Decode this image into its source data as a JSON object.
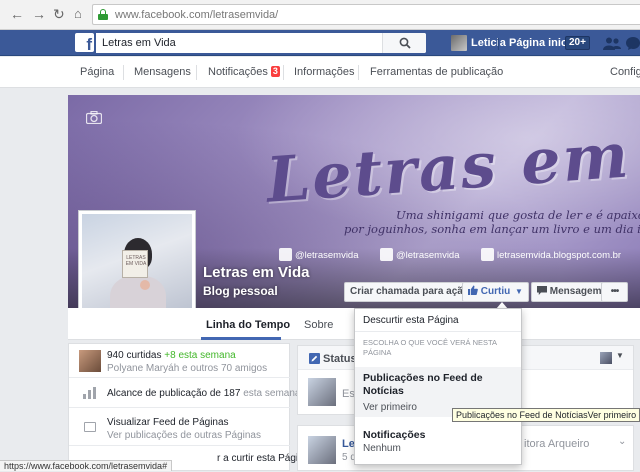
{
  "browser": {
    "url": "www.facebook.com/letrasemvida/",
    "status_url": "https://www.facebook.com/letrasemvida#"
  },
  "fb_header": {
    "search_value": "Letras em Vida",
    "user_name": "Leticia",
    "home_label": "Página inicial",
    "home_count": "20+"
  },
  "page_nav": {
    "items": [
      "Página",
      "Mensagens",
      "Notificações",
      "Informações",
      "Ferramentas de publicação"
    ],
    "notifications_count": "3",
    "settings_label": "Configu"
  },
  "cover": {
    "script_title": "Letras em vida",
    "tagline_1": "Uma shinigami que gosta de ler e é apaixonada",
    "tagline_2": "por joguinhos, sonha em lançar um livro e um dia ir ao Japão",
    "social_instagram": "@letrasemvida",
    "social_twitter": "@letrasemvida",
    "social_blog": "letrasemvida.blogspot.com.br",
    "book_text": "LETRAS EM VIDA"
  },
  "page": {
    "name": "Letras em Vida",
    "category": "Blog pessoal"
  },
  "actions": {
    "cta_label": "Criar chamada para ação",
    "liked_label": "Curtiu",
    "message_label": "Mensagem",
    "more_label": "•••"
  },
  "tabs": {
    "timeline": "Linha do Tempo",
    "about": "Sobre"
  },
  "left": {
    "likes_count": "940 curtidas",
    "likes_delta": "+8 esta semana",
    "likes_friends": "Polyane Maryáh e outros 70 amigos",
    "reach": "Alcance de publicação de 187",
    "reach_suffix": "esta semana",
    "feed_title": "Visualizar Feed de Páginas",
    "feed_sub": "Ver publicações de outras Páginas",
    "invite_partial": "r a curtir esta Página"
  },
  "feed": {
    "status_tab": "Status",
    "status_placeholder_partial": "Es",
    "post_name_partial": "Let",
    "post_date_partial": "5 de",
    "post_right_partial": "itora Arqueiro"
  },
  "dropdown": {
    "unlike_label": "Descurtir esta Página",
    "section_header": "ESCOLHA O QUE VOCÊ VERÁ NESTA PÁGINA",
    "feed_title": "Publicações no Feed de Notícias",
    "feed_value": "Ver primeiro",
    "notif_title": "Notificações",
    "notif_value": "Nenhum"
  },
  "tooltip": {
    "text": "Publicações no Feed de NotíciasVer primeiro"
  }
}
